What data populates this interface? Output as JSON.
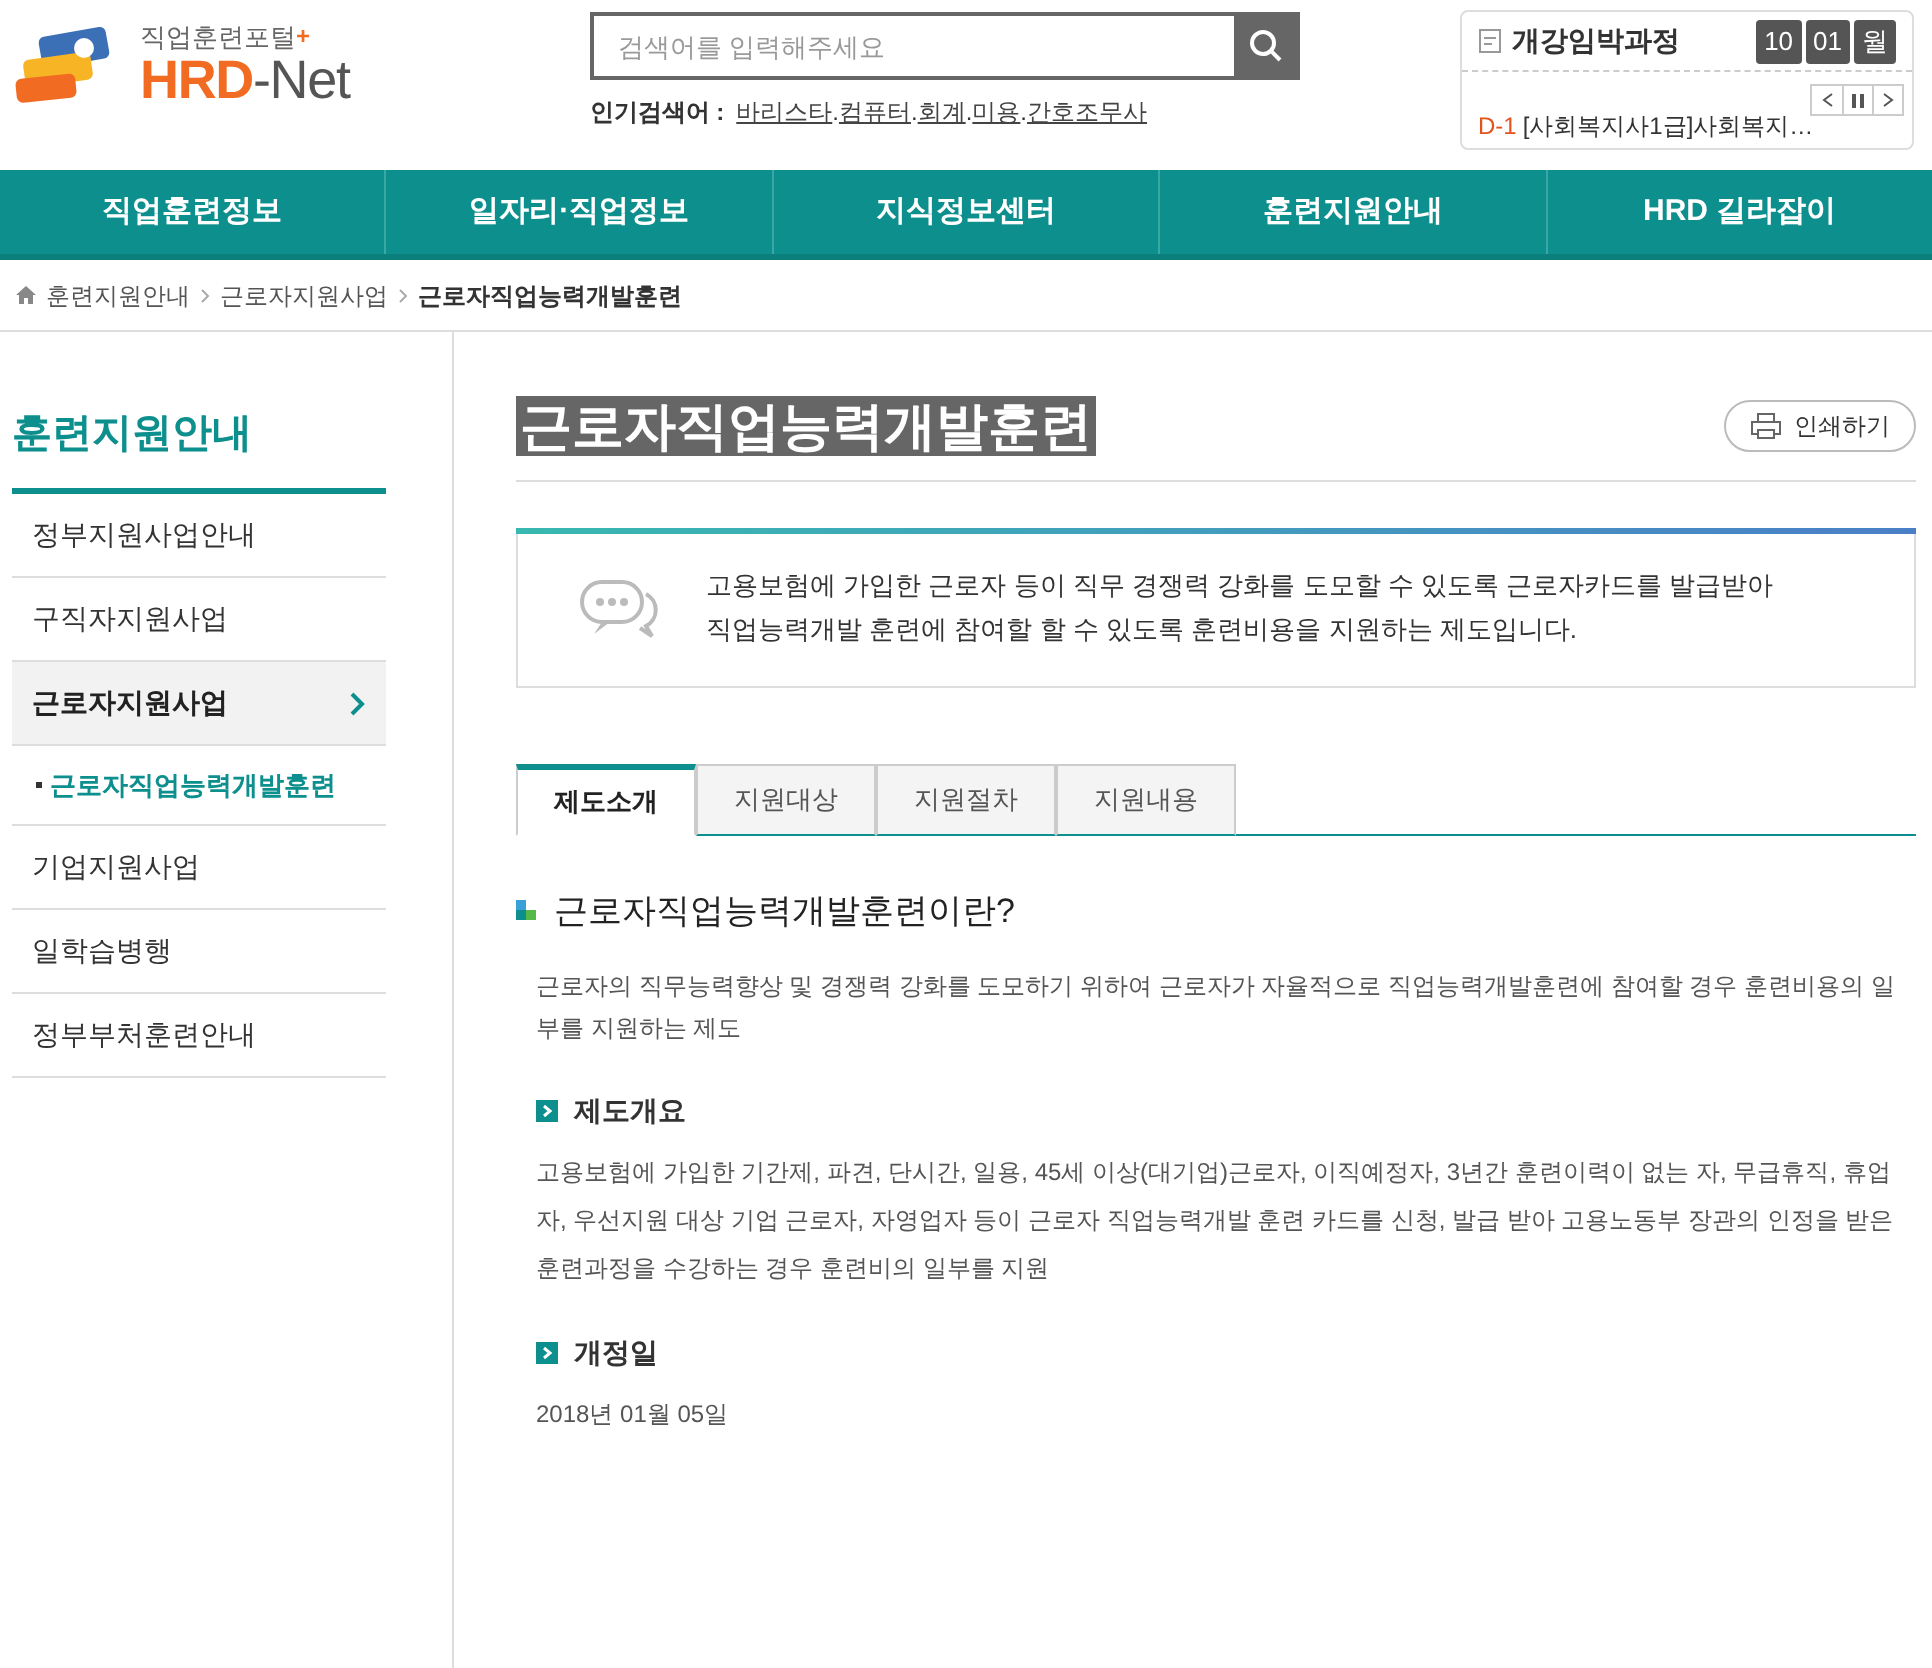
{
  "logo": {
    "subtitle": "직업훈련포털",
    "plus": "+",
    "title_main": "HRD",
    "title_sub": "-Net"
  },
  "search": {
    "placeholder": "검색어를 입력해주세요"
  },
  "popular": {
    "label": "인기검색어 :",
    "terms": [
      "바리스타",
      "컴퓨터",
      "회계",
      "미용",
      "간호조무사"
    ],
    "separator": "."
  },
  "upcoming": {
    "title": "개강임박과정",
    "month": "10",
    "day": "01",
    "weekday": "월",
    "item_dday": "D-1",
    "item_text": "[사회복지사1급]사회복지…"
  },
  "nav": [
    "직업훈련정보",
    "일자리·직업정보",
    "지식정보센터",
    "훈련지원안내",
    "HRD 길라잡이"
  ],
  "breadcrumb": [
    "훈련지원안내",
    "근로자지원사업",
    "근로자직업능력개발훈련"
  ],
  "sidebar": {
    "title": "훈련지원안내",
    "items": [
      {
        "label": "정부지원사업안내",
        "selected": false
      },
      {
        "label": "구직자지원사업",
        "selected": false
      },
      {
        "label": "근로자지원사업",
        "selected": true,
        "children": [
          {
            "label": "근로자직업능력개발훈련",
            "selected": true
          }
        ]
      },
      {
        "label": "기업지원사업",
        "selected": false
      },
      {
        "label": "일학습병행",
        "selected": false
      },
      {
        "label": "정부부처훈련안내",
        "selected": false
      }
    ]
  },
  "page_title": "근로자직업능력개발훈련",
  "print_button": "인쇄하기",
  "intro": "고용보험에 가입한 근로자 등이 직무 경쟁력 강화를 도모할 수 있도록 근로자카드를 발급받아 직업능력개발 훈련에 참여할 할 수 있도록 훈련비용을 지원하는 제도입니다.",
  "tabs": [
    {
      "label": "제도소개",
      "selected": true
    },
    {
      "label": "지원대상",
      "selected": false
    },
    {
      "label": "지원절차",
      "selected": false
    },
    {
      "label": "지원내용",
      "selected": false
    }
  ],
  "section_title": "근로자직업능력개발훈련이란?",
  "section_text": "근로자의 직무능력향상 및 경쟁력 강화를 도모하기 위하여 근로자가 자율적으로 직업능력개발훈련에 참여할 경우 훈련비용의 일부를 지원하는 제도",
  "subsections": [
    {
      "title": "제도개요",
      "text": "고용보험에 가입한 기간제, 파견, 단시간, 일용, 45세 이상(대기업)근로자, 이직예정자, 3년간 훈련이력이 없는 자, 무급휴직, 휴업자, 우선지원 대상 기업 근로자, 자영업자 등이 근로자 직업능력개발 훈련 카드를 신청, 발급 받아 고용노동부 장관의 인정을 받은 훈련과정을 수강하는 경우 훈련비의 일부를 지원"
    },
    {
      "title": "개정일",
      "text": "2018년 01월 05일"
    }
  ]
}
